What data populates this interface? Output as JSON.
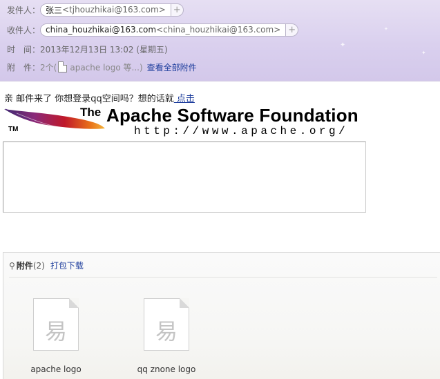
{
  "header": {
    "from_label": "发件人：",
    "from_name": "张三",
    "from_addr": "<tjhouzhikai@163.com>",
    "to_label": "收件人：",
    "to_name": "china_houzhikai@163.com",
    "to_addr": "<china_houzhikai@163.com>",
    "add_symbol": "+",
    "time_label": "时　间：",
    "time_value": "2013年12月13日 13:02 (星期五)",
    "attach_label": "附　件：",
    "attach_count": "2个(",
    "attach_preview": "apache logo 等...)",
    "view_all": "查看全部附件"
  },
  "body": {
    "text": "亲 邮件来了 你想登录qq空间吗？想的话就",
    "link": " 点击 "
  },
  "logo": {
    "the": "The",
    "title": "Apache Software Foundation",
    "url": "http://www.apache.org/",
    "tm": "TM"
  },
  "attachments": {
    "title": "附件",
    "count": "(2)",
    "download_all": "打包下载",
    "items": [
      {
        "name": "apache logo",
        "glyph": "易"
      },
      {
        "name": "qq znone logo",
        "glyph": "易"
      }
    ]
  },
  "colors": {
    "header_bg": "#d9cfee",
    "link": "#1c3c9c",
    "feather_red": "#c0182a",
    "feather_purple": "#5a2a82"
  }
}
